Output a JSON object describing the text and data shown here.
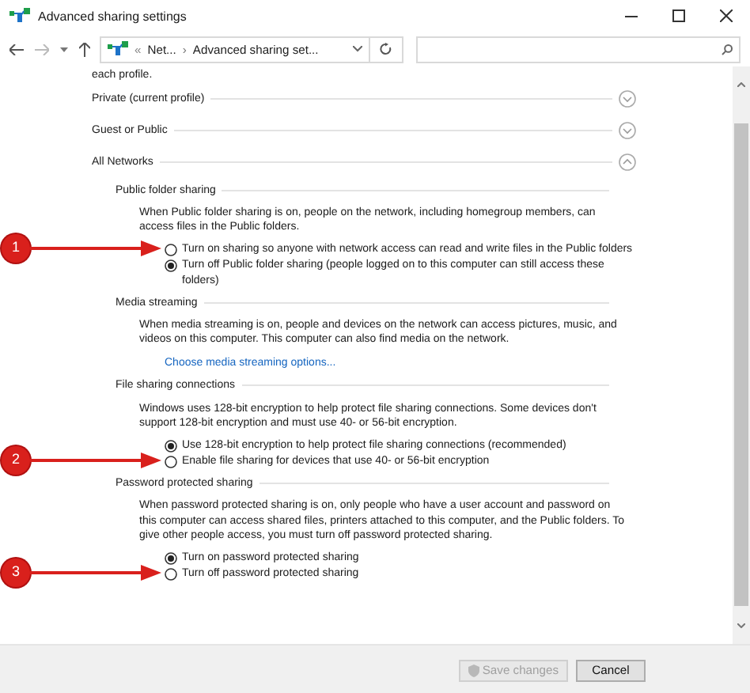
{
  "window": {
    "title": "Advanced sharing settings"
  },
  "address_bar": {
    "overflow": "«",
    "crumbs": [
      "Net...",
      "Advanced sharing set..."
    ],
    "separator": "›"
  },
  "intro_tail": "each profile.",
  "profiles": [
    {
      "name": "Private (current profile)",
      "expanded": false
    },
    {
      "name": "Guest or Public",
      "expanded": false
    },
    {
      "name": "All Networks",
      "expanded": true,
      "sections": [
        {
          "title": "Public folder sharing",
          "description": "When Public folder sharing is on, people on the network, including homegroup members, can access files in the Public folders.",
          "options": [
            {
              "label": "Turn on sharing so anyone with network access can read and write files in the Public folders",
              "selected": false,
              "callout": "1"
            },
            {
              "label": "Turn off Public folder sharing (people logged on to this computer can still access these folders)",
              "selected": true
            }
          ]
        },
        {
          "title": "Media streaming",
          "description": "When media streaming is on, people and devices on the network can access pictures, music, and videos on this computer. This computer can also find media on the network.",
          "link": "Choose media streaming options..."
        },
        {
          "title": "File sharing connections",
          "description": "Windows uses 128-bit encryption to help protect file sharing connections. Some devices don't support 128-bit encryption and must use 40- or 56-bit encryption.",
          "options": [
            {
              "label": "Use 128-bit encryption to help protect file sharing connections (recommended)",
              "selected": true
            },
            {
              "label": "Enable file sharing for devices that use 40- or 56-bit encryption",
              "selected": false,
              "callout": "2"
            }
          ]
        },
        {
          "title": "Password protected sharing",
          "description": "When password protected sharing is on, only people who have a user account and password on this computer can access shared files, printers attached to this computer, and the Public folders. To give other people access, you must turn off password protected sharing.",
          "options": [
            {
              "label": "Turn on password protected sharing",
              "selected": true
            },
            {
              "label": "Turn off password protected sharing",
              "selected": false,
              "callout": "3"
            }
          ]
        }
      ]
    }
  ],
  "buttons": [
    {
      "label": "Save changes",
      "disabled": true
    },
    {
      "label": "Cancel",
      "disabled": false
    }
  ]
}
